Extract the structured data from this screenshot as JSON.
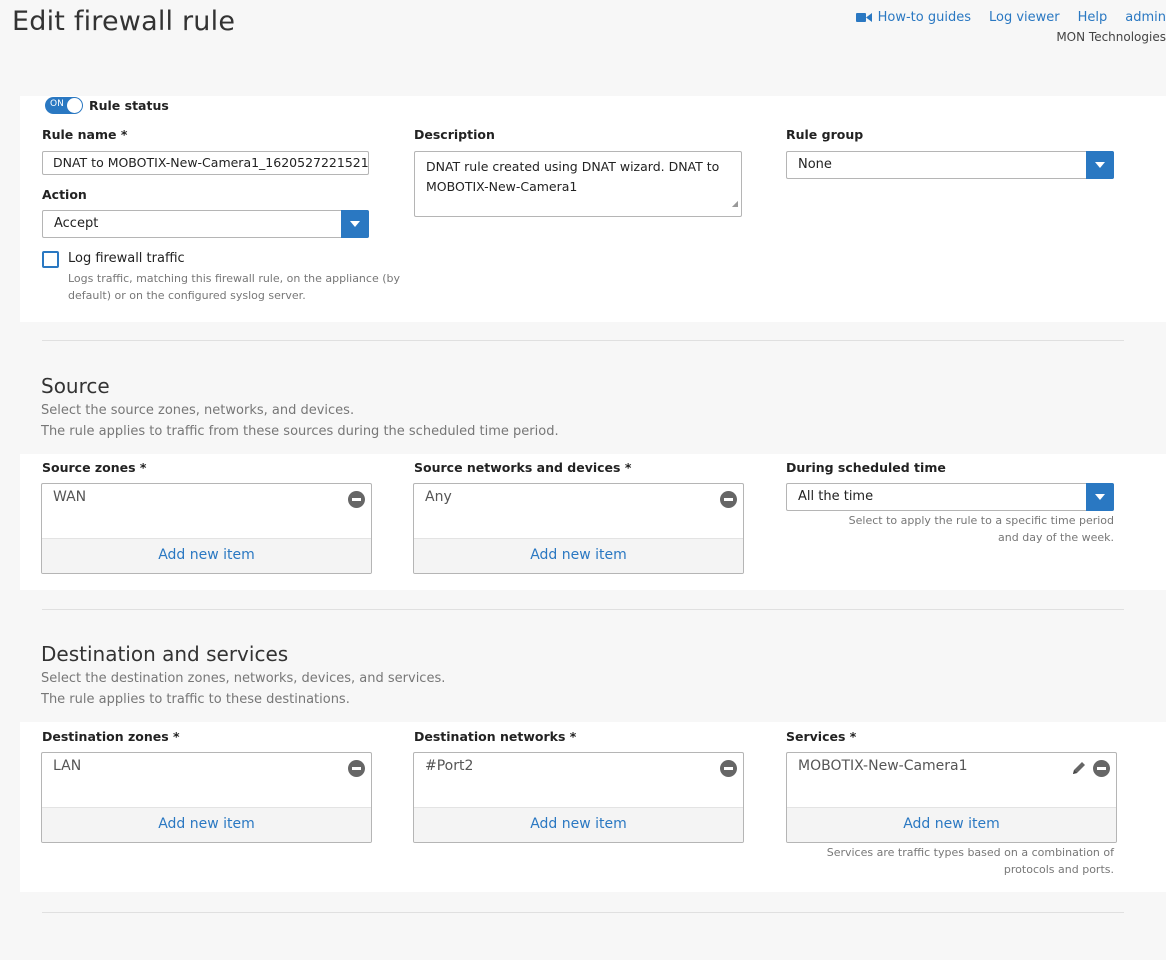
{
  "header": {
    "title": "Edit firewall rule",
    "links": {
      "howto": "How-to guides",
      "logviewer": "Log viewer",
      "help": "Help",
      "user": "admin"
    },
    "org": "MON Technologies"
  },
  "rule": {
    "status_toggle": "ON",
    "status_label": "Rule status",
    "name_label": "Rule name *",
    "name_value": "DNAT to MOBOTIX-New-Camera1_1620527221521",
    "description_label": "Description",
    "description_value": "DNAT rule created using DNAT wizard. DNAT to MOBOTIX-New-Camera1",
    "group_label": "Rule group",
    "group_value": "None",
    "action_label": "Action",
    "action_value": "Accept",
    "log_label": "Log firewall traffic",
    "log_help": "Logs traffic, matching this firewall rule, on the appliance (by default) or on the configured syslog server."
  },
  "source": {
    "title": "Source",
    "desc1": "Select the source zones, networks, and devices.",
    "desc2": "The rule applies to traffic from these sources during the scheduled time period.",
    "zones_label": "Source zones *",
    "zones_item": "WAN",
    "networks_label": "Source networks and devices *",
    "networks_item": "Any",
    "schedule_label": "During scheduled time",
    "schedule_value": "All the time",
    "schedule_help": "Select to apply the rule to a specific time period and day of the week.",
    "add_new": "Add new item"
  },
  "destination": {
    "title": "Destination and services",
    "desc1": "Select the destination zones, networks, devices, and services.",
    "desc2": "The rule applies to traffic to these destinations.",
    "zones_label": "Destination zones *",
    "zones_item": "LAN",
    "networks_label": "Destination networks *",
    "networks_item": "#Port2",
    "services_label": "Services *",
    "services_item": "MOBOTIX-New-Camera1",
    "services_help": "Services are traffic types based on a combination of protocols and ports.",
    "add_new": "Add new item"
  },
  "icons": {
    "howto": "video-camera-icon",
    "remove": "minus-circle-icon",
    "edit": "pencil-icon",
    "dropdown": "chevron-down-icon"
  },
  "colors": {
    "accent": "#2a78c2",
    "panel": "#ffffff",
    "background": "#f7f7f7"
  }
}
